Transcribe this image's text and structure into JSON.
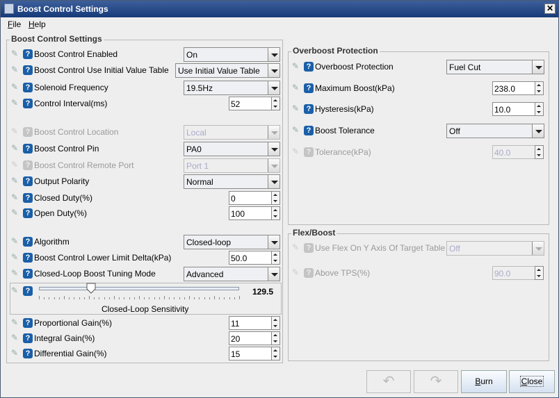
{
  "window": {
    "title": "Boost Control Settings",
    "close_label": "✕"
  },
  "menu": [
    {
      "label": "File",
      "mn": "F",
      "rest": "ile"
    },
    {
      "label": "Help",
      "mn": "H",
      "rest": "elp"
    }
  ],
  "left_group": {
    "title": "Boost Control Settings",
    "rows": [
      {
        "label": "Boost Control Enabled",
        "type": "combo",
        "value": "On",
        "enabled": true
      },
      {
        "label": "Boost Control Use Initial Value Table",
        "type": "combo",
        "value": "Use Initial Value Table",
        "enabled": true,
        "wide": true
      },
      {
        "label": "Solenoid Frequency",
        "type": "combo",
        "value": "19.5Hz",
        "enabled": true
      },
      {
        "label": "Control Interval(ms)",
        "type": "spin",
        "value": "52",
        "enabled": true
      },
      {
        "label": "Boost Control Location",
        "type": "combo",
        "value": "Local",
        "enabled": false
      },
      {
        "label": "Boost Control Pin",
        "type": "combo",
        "value": "PA0",
        "enabled": true
      },
      {
        "label": "Boost Control Remote Port",
        "type": "combo",
        "value": "Port 1",
        "enabled": false
      },
      {
        "label": "Output Polarity",
        "type": "combo",
        "value": "Normal",
        "enabled": true
      },
      {
        "label": "Closed Duty(%)",
        "type": "spin",
        "value": "0",
        "enabled": true
      },
      {
        "label": "Open Duty(%)",
        "type": "spin",
        "value": "100",
        "enabled": true
      },
      {
        "label": "Algorithm",
        "type": "combo",
        "value": "Closed-loop",
        "enabled": true
      },
      {
        "label": "Boost Control Lower Limit Delta(kPa)",
        "type": "spin",
        "value": "50.0",
        "enabled": true
      },
      {
        "label": "Closed-Loop Boost Tuning Mode",
        "type": "combo",
        "value": "Advanced",
        "enabled": true
      },
      {
        "label": "Proportional Gain(%)",
        "type": "spin",
        "value": "11",
        "enabled": true
      },
      {
        "label": "Integral Gain(%)",
        "type": "spin",
        "value": "20",
        "enabled": true
      },
      {
        "label": "Differential Gain(%)",
        "type": "spin",
        "value": "15",
        "enabled": true
      }
    ],
    "slider": {
      "label": "Closed-Loop Sensitivity",
      "value": "129.5",
      "fraction": 0.26
    }
  },
  "overboost": {
    "title": "Overboost Protection",
    "rows": [
      {
        "label": "Overboost Protection",
        "type": "combo",
        "value": "Fuel Cut",
        "enabled": true
      },
      {
        "label": "Maximum Boost(kPa)",
        "type": "spin",
        "value": "238.0",
        "enabled": true
      },
      {
        "label": "Hysteresis(kPa)",
        "type": "spin",
        "value": "10.0",
        "enabled": true
      },
      {
        "label": "Boost Tolerance",
        "type": "combo",
        "value": "Off",
        "enabled": true
      },
      {
        "label": "Tolerance(kPa)",
        "type": "spin",
        "value": "40.0",
        "enabled": false
      }
    ]
  },
  "flex": {
    "title": "Flex/Boost",
    "rows": [
      {
        "label": "Use Flex On Y Axis Of Target Table",
        "type": "combo",
        "value": "Off",
        "enabled": false
      },
      {
        "label": "Above TPS(%)",
        "type": "spin",
        "value": "90.0",
        "enabled": false
      }
    ]
  },
  "buttons": {
    "undo": "↶",
    "redo": "↷",
    "burn_mn": "B",
    "burn_rest": "urn",
    "close_mn": "C",
    "close_rest": "lose"
  }
}
